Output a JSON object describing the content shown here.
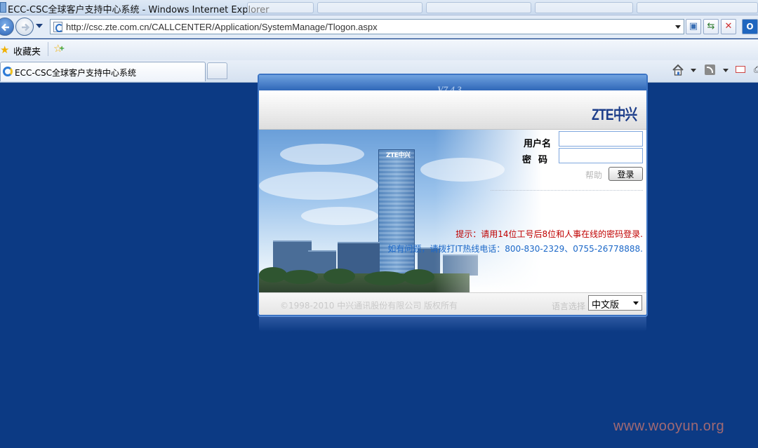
{
  "window": {
    "title": "ECC-CSC全球客户支持中心系统 - Windows Internet Explorer"
  },
  "address_bar": {
    "url": "http://csc.zte.com.cn/CALLCENTER/Application/SystemManage/Tlogon.aspx"
  },
  "favorites_bar": {
    "label": "收藏夹"
  },
  "tabs": [
    {
      "label": "ECC-CSC全球客户支持中心系统",
      "active": true
    }
  ],
  "login": {
    "version": "V7.4.3",
    "logo_text": "ZTE中兴",
    "tower_logo": "ZTE中兴",
    "username_label": "用户名",
    "username_value": "",
    "password_label": "密码",
    "password_value": "",
    "help_link": "帮助",
    "login_button": "登录",
    "hint": "提示：请用14位工号后8位和人事在线的密码登录.",
    "support": "如有问题，请拨打IT热线电话：800-830-2329、0755-26778888.",
    "copyright": "©1998-2010 中兴通讯股份有限公司 版权所有",
    "language_label": "语言选择",
    "language_value": "中文版"
  },
  "watermark": "www.wooyun.org",
  "colors": {
    "page_background": "#0c3a84",
    "hint_red": "#c00000",
    "support_blue": "#1c68c8",
    "brand_navy": "#1c3d8a"
  },
  "icons": [
    "back-arrow-icon",
    "forward-arrow-icon",
    "page-icon",
    "compat-view-icon",
    "refresh-icon",
    "stop-icon",
    "search-provider-icon",
    "favorites-star-icon",
    "add-favorite-icon",
    "ie-logo-icon",
    "home-icon",
    "feeds-icon",
    "mail-icon",
    "print-icon"
  ]
}
